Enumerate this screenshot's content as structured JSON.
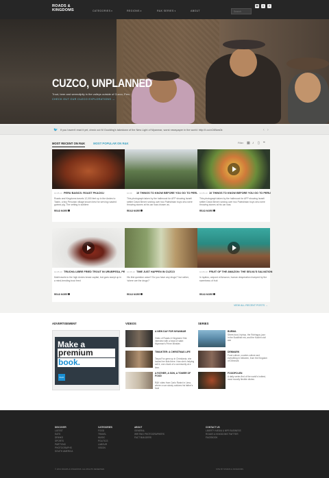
{
  "header": {
    "logo": "Roads & Kingdoms",
    "nav": [
      "Categories",
      "Regions",
      "R&K Series",
      "About"
    ],
    "search_placeholder": "Search",
    "social_icons": [
      "email-icon",
      "twitter-icon",
      "facebook-icon"
    ]
  },
  "hero": {
    "title": "CUZCO, UNPLANNED",
    "subtitle": "Trout, beer and serendipity in the valleys outside of Cuzco, Peru",
    "cta": "Check out our Cuzco explorations →"
  },
  "ticker": {
    "text": "If you haven't read it yet, check out M Goulding's takedown of the New Light of Myanmar, worst newspaper in the world: http://t.co/oC6Bws0k"
  },
  "tabs": [
    "Most recent on R&K",
    "Most popular on R&K"
  ],
  "filter_label": "Filter",
  "cards": [
    {
      "meta": "10.05.13",
      "title": "Peru Basics: Roast Pkacku",
      "excerpt": "Roads and Kingdoms travels 12,000 feet up in the Andes to Tastin, a tiny Peruvian village known best for serving roasted guinea pig. The setting is sublime.",
      "read_more": "Read more"
    },
    {
      "meta": "10.09",
      "title": "10 things to know before you go to Peru",
      "excerpt": "This photograph taken by the hallmoozt for AFP showing Israeli settler David Benet running over two Palestinian boys who were throwing stones at his car was chosen as.",
      "read_more": "Read more"
    },
    {
      "meta": "10.05.13",
      "title": "10 things to know before you go to Peru",
      "excerpt": "This photograph taken by the hallmoozt for AFP showing Israeli settler David Benet running over two Palestinian boys who were throwing stones at his car was.",
      "read_more": "Read more"
    },
    {
      "meta": "10.05.13",
      "title": "Trucha libre fried trout in Urubpesa, Peru",
      "excerpt": "Matt travels to the high Andes bread capital, but goes swept up in a mind-bending trout feed",
      "read_more": "Read more"
    },
    {
      "meta": "10.05.13",
      "title": "Time just happen in Cuzco",
      "excerpt": "His first question wasn't 'Do you have any drugs?' but rather, 'where are the drugs?'",
      "read_more": "Read more"
    },
    {
      "meta": "10.05.13",
      "title": "Fruit of the Amazon: The Selva's salvation",
      "excerpt": "In Iquitos, outpost of Amazon, human desperation trumped by the sweetness of fruit",
      "read_more": "Read more"
    }
  ],
  "view_all": "View all recent posts →",
  "sidebar": {
    "advertisement_title": "Advertisement",
    "ad_line1": "Make a",
    "ad_line2": "premium",
    "ad_line3": "book.",
    "ad_brand": "blurb",
    "videos_title": "Videos",
    "videos": [
      {
        "title": "A new day for Myanmar",
        "desc": "Video of Roads & Kingdoms' first interview with a head of state: Myanmar's Prime Minister."
      },
      {
        "title": "Tiniukter: A Christmas life",
        "desc": "Tanya Fox grew up in Christiania, she looked her kids there. How she's helping sell it, one chunk of a community at a time."
      },
      {
        "title": "A father, a son, a tower of food",
        "desc": "R&K video from Carlo Ranini in Lima, where a son slowly outdoes his father's food"
      }
    ],
    "series_title": "Series",
    "series": [
      {
        "title": "Burma",
        "desc": "Street-food, hiphop, the Rohingya, jazz in the Buddhist era, and the Kachin civil war"
      },
      {
        "title": "Denmark",
        "desc": "Food culture, counter-culture and everything in between, from the Kingdom of Denmark"
      },
      {
        "title": "Foodpolen",
        "desc": "A daily series find of the world's hottest, most morally flexible dishes"
      }
    ]
  },
  "footer": {
    "cols": [
      {
        "head": "Discover",
        "items": [
          "Latest",
          "Eats",
          "Drinks",
          "Sports",
          "Partying",
          "Photographs",
          "South America"
        ]
      },
      {
        "head": "Categories",
        "items": [
          "Food",
          "Travel",
          "Music",
          "Politics",
          "Labour",
          "Vision"
        ]
      },
      {
        "head": "About",
        "items": [
          "General",
          "Writing Photographers",
          "Fact Builders"
        ]
      },
      {
        "head": "Contact us",
        "items": [
          "Liberty Media & NPR Business",
          "Roads & Kingdoms Twitter",
          "Facebook"
        ]
      }
    ],
    "copyright": "© 2013 Roads & Kingdoms. All rights reserved.",
    "credit": "Site by Roads & Kingdoms"
  },
  "colors": {
    "accent": "#3aa0c0",
    "topbar": "#262626",
    "footer": "#222222"
  }
}
